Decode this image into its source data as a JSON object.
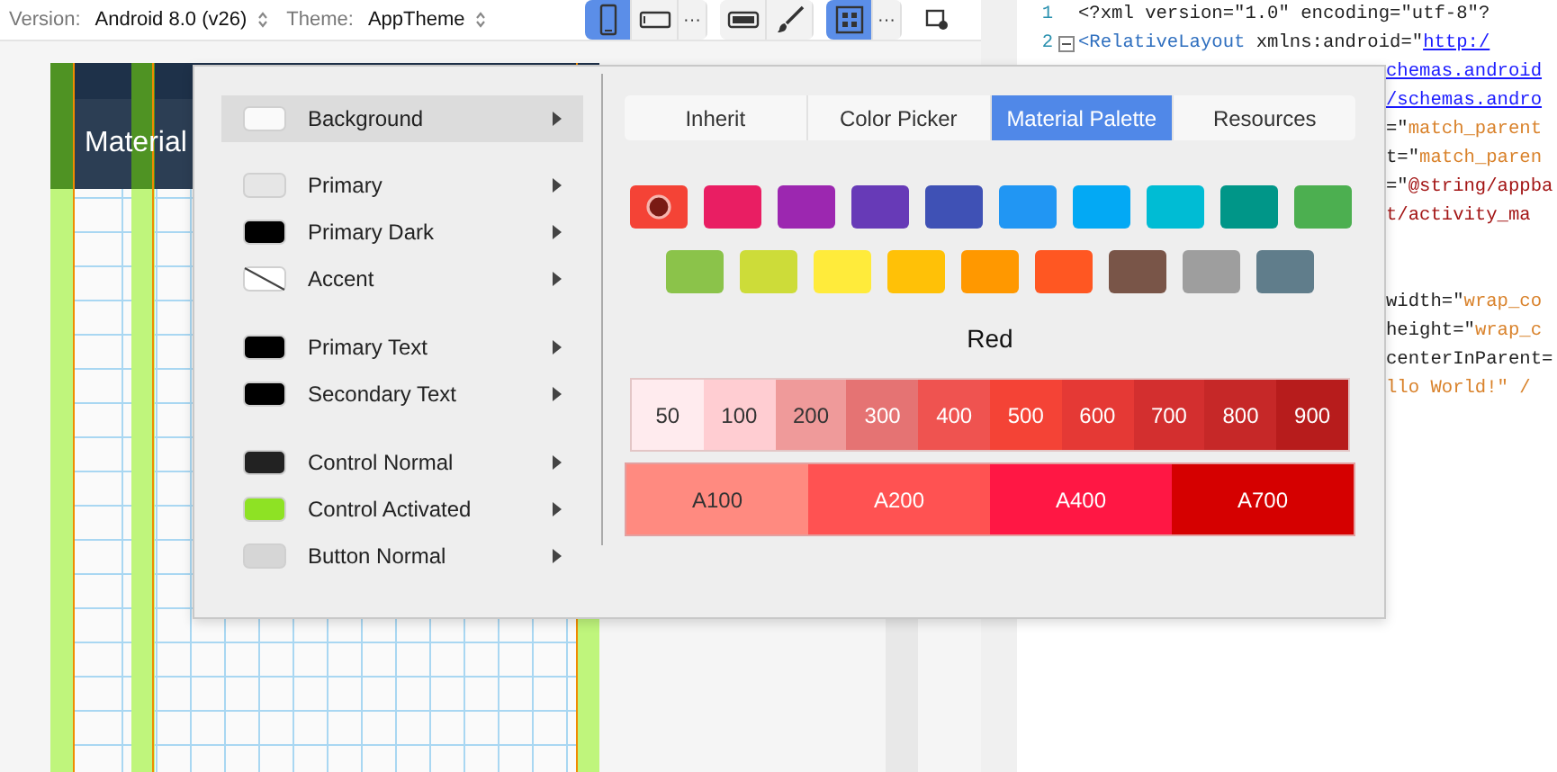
{
  "toolbar": {
    "version_label": "Version:",
    "version_value": "Android 8.0 (v26)",
    "theme_label": "Theme:",
    "theme_value": "AppTheme",
    "groups": [
      {
        "buttons": [
          {
            "kind": "portrait",
            "selected": true
          },
          {
            "kind": "landscape",
            "selected": false
          },
          {
            "kind": "more",
            "label": "···",
            "selected": false
          }
        ]
      },
      {
        "buttons": [
          {
            "kind": "screen",
            "selected": false
          },
          {
            "kind": "brush",
            "selected": false
          }
        ]
      },
      {
        "buttons": [
          {
            "kind": "blueprint",
            "selected": true
          },
          {
            "kind": "more",
            "label": "···",
            "selected": false
          }
        ]
      }
    ]
  },
  "preview": {
    "header_title": "Material"
  },
  "editor": {
    "lines": [
      {
        "number": "1",
        "fold": false,
        "tokens": [
          {
            "text": "<?xml version=",
            "kind": "plain"
          },
          {
            "text": "\"1.0\"",
            "kind": "plain"
          },
          {
            "text": " encoding=\"utf-8\"?",
            "kind": "plain"
          }
        ]
      },
      {
        "number": "2",
        "fold": true,
        "tokens": [
          {
            "text": "<RelativeLayout",
            "kind": "tag"
          },
          {
            "text": " xmlns:android=\"",
            "kind": "plain"
          },
          {
            "text": "http:/",
            "kind": "link"
          }
        ]
      }
    ],
    "fragment_blocks": [
      [
        [
          {
            "text": "chemas.android",
            "kind": "link"
          }
        ],
        [
          {
            "text": "/schemas.andro",
            "kind": "link"
          }
        ],
        [
          {
            "text": "=\"",
            "kind": "plain"
          },
          {
            "text": "match_parent",
            "kind": "value"
          }
        ],
        [
          {
            "text": "t=\"",
            "kind": "plain"
          },
          {
            "text": "match_paren",
            "kind": "value"
          }
        ],
        [
          {
            "text": "=\"",
            "kind": "plain"
          },
          {
            "text": "@string/appba",
            "kind": "string"
          }
        ],
        [
          {
            "text": "t/activity_ma",
            "kind": "string"
          }
        ]
      ],
      [
        [
          {
            "text": "width=\"",
            "kind": "plain"
          },
          {
            "text": "wrap_co",
            "kind": "value"
          }
        ],
        [
          {
            "text": "height=\"",
            "kind": "plain"
          },
          {
            "text": "wrap_c",
            "kind": "value"
          }
        ],
        [
          {
            "text": "centerInParent=",
            "kind": "plain"
          }
        ],
        [
          {
            "text": "llo World!\" /",
            "kind": "value"
          }
        ]
      ]
    ]
  },
  "popup": {
    "menu_groups": [
      [
        {
          "label": "Background",
          "kind": "color",
          "color": "#fafafa",
          "selected": true
        }
      ],
      [
        {
          "label": "Primary",
          "kind": "color",
          "color": "#e6e6e6",
          "selected": false
        },
        {
          "label": "Primary Dark",
          "kind": "color",
          "color": "#000000",
          "selected": false
        },
        {
          "label": "Accent",
          "kind": "unset",
          "color": "#ffffff",
          "selected": false
        }
      ],
      [
        {
          "label": "Primary Text",
          "kind": "color",
          "color": "#000000",
          "selected": false
        },
        {
          "label": "Secondary Text",
          "kind": "color",
          "color": "#000000",
          "selected": false
        }
      ],
      [
        {
          "label": "Control Normal",
          "kind": "color",
          "color": "#222222",
          "selected": false
        },
        {
          "label": "Control Activated",
          "kind": "color",
          "color": "#8ee224",
          "selected": false
        },
        {
          "label": "Button Normal",
          "kind": "color",
          "color": "#d6d6d6",
          "selected": false
        }
      ]
    ],
    "tabs": [
      {
        "label": "Inherit",
        "selected": false
      },
      {
        "label": "Color Picker",
        "selected": false
      },
      {
        "label": "Material Palette",
        "selected": true
      },
      {
        "label": "Resources",
        "selected": false
      }
    ],
    "palette_rows": [
      [
        {
          "color": "#f44336",
          "selected": true
        },
        {
          "color": "#e91e63",
          "selected": false
        },
        {
          "color": "#9c27b0",
          "selected": false
        },
        {
          "color": "#673ab7",
          "selected": false
        },
        {
          "color": "#3f51b5",
          "selected": false
        },
        {
          "color": "#2196f3",
          "selected": false
        },
        {
          "color": "#03a9f4",
          "selected": false
        },
        {
          "color": "#00bcd4",
          "selected": false
        },
        {
          "color": "#009688",
          "selected": false
        },
        {
          "color": "#4caf50",
          "selected": false
        }
      ],
      [
        {
          "color": "#8bc34a",
          "selected": false
        },
        {
          "color": "#cddc39",
          "selected": false
        },
        {
          "color": "#ffeb3b",
          "selected": false
        },
        {
          "color": "#ffc107",
          "selected": false
        },
        {
          "color": "#ff9800",
          "selected": false
        },
        {
          "color": "#ff5722",
          "selected": false
        },
        {
          "color": "#795548",
          "selected": false
        },
        {
          "color": "#9e9e9e",
          "selected": false
        },
        {
          "color": "#607d8b",
          "selected": false
        }
      ]
    ],
    "palette_name": "Red",
    "shades": [
      {
        "label": "50",
        "color": "#ffebee"
      },
      {
        "label": "100",
        "color": "#ffcdd2"
      },
      {
        "label": "200",
        "color": "#ef9a9a"
      },
      {
        "label": "300",
        "color": "#e57373"
      },
      {
        "label": "400",
        "color": "#ef5350"
      },
      {
        "label": "500",
        "color": "#f44336"
      },
      {
        "label": "600",
        "color": "#e53935"
      },
      {
        "label": "700",
        "color": "#d32f2f"
      },
      {
        "label": "800",
        "color": "#c62828"
      },
      {
        "label": "900",
        "color": "#b71c1c"
      }
    ],
    "accents": [
      {
        "label": "A100",
        "color": "#ff8a80"
      },
      {
        "label": "A200",
        "color": "#ff5252"
      },
      {
        "label": "A400",
        "color": "#ff1744"
      },
      {
        "label": "A700",
        "color": "#d50000"
      }
    ]
  }
}
